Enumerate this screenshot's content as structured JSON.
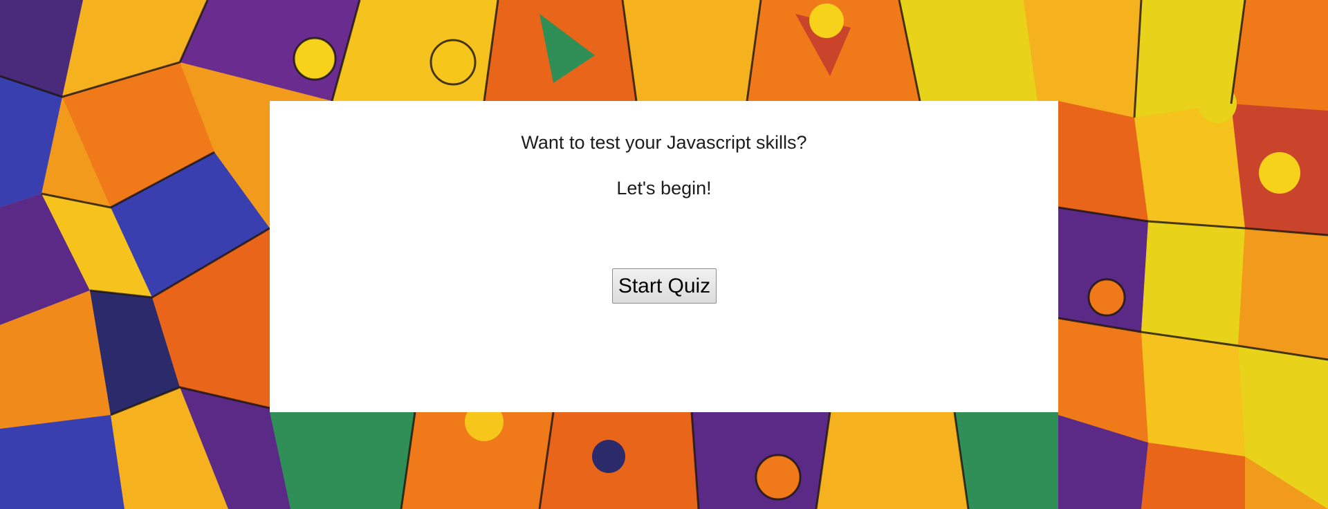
{
  "quiz": {
    "prompt": "Want to test your Javascript skills?",
    "subprompt": "Let's begin!",
    "start_label": "Start Quiz"
  },
  "colors": {
    "card_background": "#ffffff",
    "text": "#1c1c1c",
    "background_palette": [
      "#f5a21b",
      "#f07a1a",
      "#e9d21a",
      "#5b2a86",
      "#3a3fb0",
      "#2f8f57",
      "#c9442a"
    ]
  }
}
